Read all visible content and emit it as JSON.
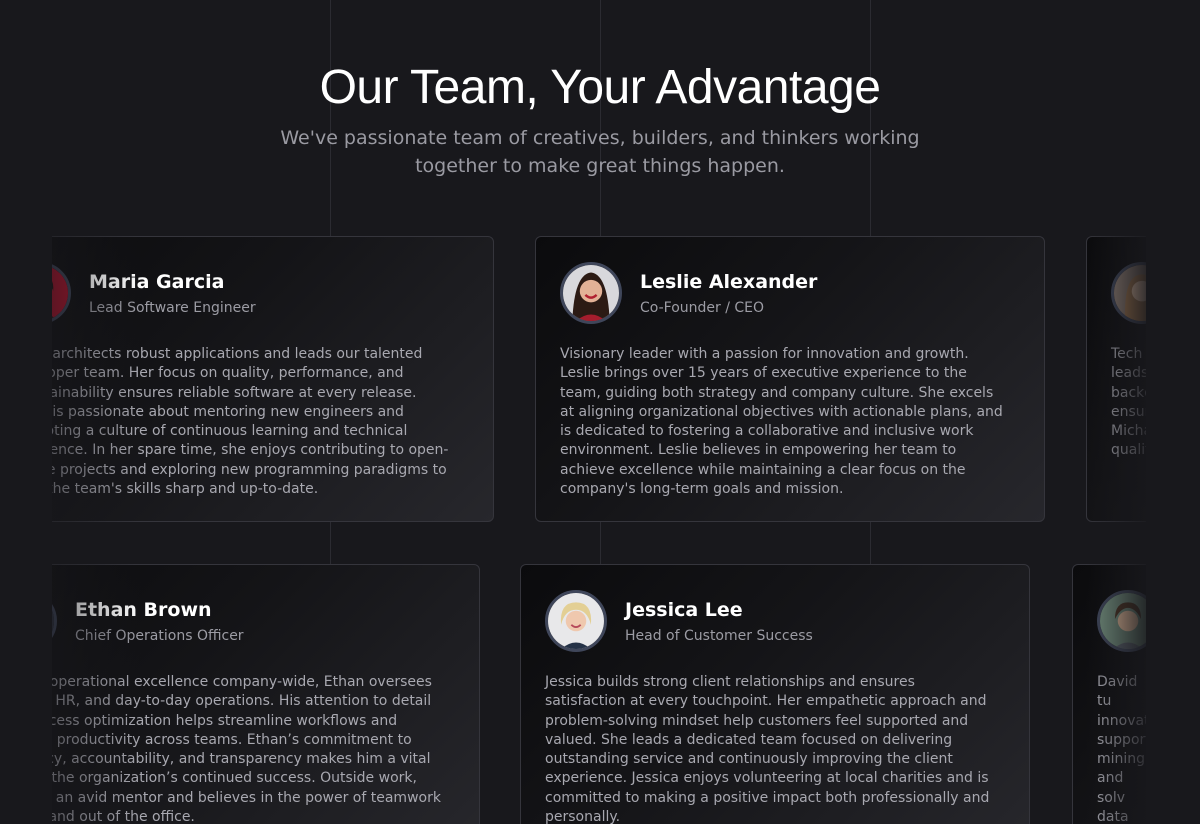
{
  "hero": {
    "title": "Our Team, Your Advantage",
    "subtitle": "We've passionate team of creatives, builders, and thinkers working together to make great things happen."
  },
  "row1": [
    {
      "name": "Maria Garcia",
      "role": "Lead Software Engineer",
      "bio": "Maria architects robust applications and leads our talented developer team. Her focus on quality, performance, and maintainability ensures reliable software at every release. Maria is passionate about mentoring new engineers and promoting a culture of continuous learning and technical excellence. In her spare time, she enjoys contributing to open-source projects and exploring new programming paradigms to keep the team's skills sharp and up-to-date.",
      "avatar": "avatar-red-background"
    },
    {
      "name": "Leslie Alexander",
      "role": "Co-Founder / CEO",
      "bio": "Visionary leader with a passion for innovation and growth. Leslie brings over 15 years of executive experience to the team, guiding both strategy and company culture. She excels at aligning organizational objectives with actionable plans, and is dedicated to fostering a collaborative and inclusive work environment. Leslie believes in empowering her team to achieve excellence while maintaining a clear focus on the company's long-term goals and mission.",
      "avatar": "avatar-dark-hair-smiling"
    },
    {
      "name": "",
      "role": "",
      "bio": "Tech i leads backg ensur Micha qualit",
      "avatar": "avatar-long-hair"
    }
  ],
  "row2": [
    {
      "name": "Ethan Brown",
      "role": "Chief Operations Officer",
      "bio": "Driving operational excellence company-wide, Ethan oversees finance, HR, and day-to-day operations. His attention to detail and process optimization helps streamline workflows and improve productivity across teams. Ethan’s commitment to efficiency, accountability, and transparency makes him a vital pillar in the organization’s continued success. Outside work, Ethan is an avid mentor and believes in the power of teamwork both in and out of the office.",
      "avatar": "avatar-dark"
    },
    {
      "name": "Jessica Lee",
      "role": "Head of Customer Success",
      "bio": "Jessica builds strong client relationships and ensures satisfaction at every touchpoint. Her empathetic approach and problem-solving mindset help customers feel supported and valued. She leads a dedicated team focused on delivering outstanding service and continuously improving the client experience. Jessica enjoys volunteering at local charities and is committed to making a positive impact both professionally and personally.",
      "avatar": "avatar-blonde-short-hair"
    },
    {
      "name": "",
      "role": "",
      "bio": "David tu innovat support mining and solv data wo",
      "avatar": "avatar-curly-hair"
    }
  ]
}
